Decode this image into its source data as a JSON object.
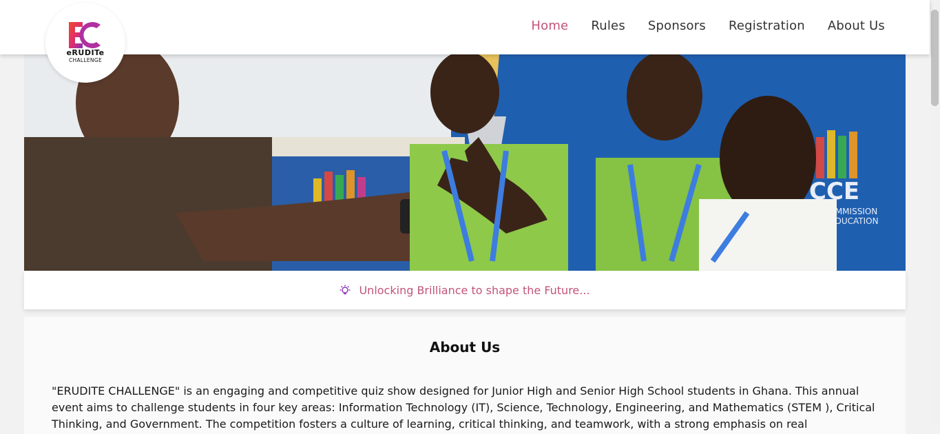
{
  "nav": {
    "items": [
      {
        "label": "Home",
        "active": true
      },
      {
        "label": "Rules",
        "active": false
      },
      {
        "label": "Sponsors",
        "active": false
      },
      {
        "label": "Registration",
        "active": false
      },
      {
        "label": "About Us",
        "active": false
      }
    ]
  },
  "logo": {
    "line1": "eRUDITe",
    "line2": "CHALLENGE"
  },
  "tagline": {
    "text": "Unlocking Brilliance to shape the Future..."
  },
  "about": {
    "heading": "About Us",
    "body": "\"ERUDITE CHALLENGE\" is an engaging and competitive quiz show designed for Junior High and Senior High School students in Ghana. This annual event aims to challenge students in four key areas: Information Technology (IT), Science, Technology, Engineering, and Mathematics (STEM ), Critical Thinking, and Government. The competition fosters a culture of learning, critical thinking, and teamwork, with a strong emphasis on real"
  },
  "colors": {
    "accent": "#c2547a",
    "logo_red": "#e0303a",
    "logo_purple": "#8a2fb8"
  },
  "icons": {
    "tagline": "lightbulb-icon"
  }
}
